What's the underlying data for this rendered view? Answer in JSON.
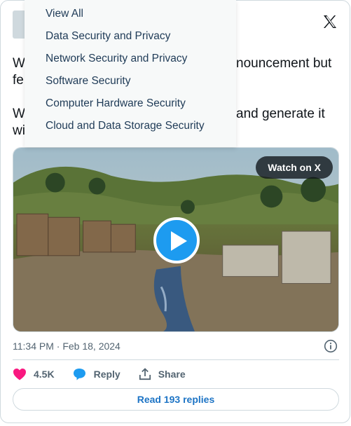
{
  "tweet": {
    "text_line1_start": "W",
    "text_line1_end": "nouncement but",
    "text_line2_start": "fe",
    "text_line3_start": "W",
    "text_line3_end": "and generate it",
    "text_line4_start": "wi"
  },
  "media": {
    "watch_label": "Watch on X"
  },
  "meta": {
    "timestamp": "11:34 PM · Feb 18, 2024"
  },
  "actions": {
    "like_count": "4.5K",
    "reply_label": "Reply",
    "share_label": "Share"
  },
  "replies_button": "Read 193 replies",
  "dropdown": {
    "items": [
      "View All",
      "Data Security and Privacy",
      "Network Security and Privacy",
      "Software Security",
      "Computer Hardware Security",
      "Cloud and Data Storage Security"
    ]
  },
  "colors": {
    "accent": "#1d9bf0",
    "like": "#f91880",
    "link": "#1d74c5"
  },
  "icons": [
    "x-logo-icon",
    "play-icon",
    "info-icon",
    "heart-icon",
    "reply-bubble-icon",
    "share-icon"
  ]
}
